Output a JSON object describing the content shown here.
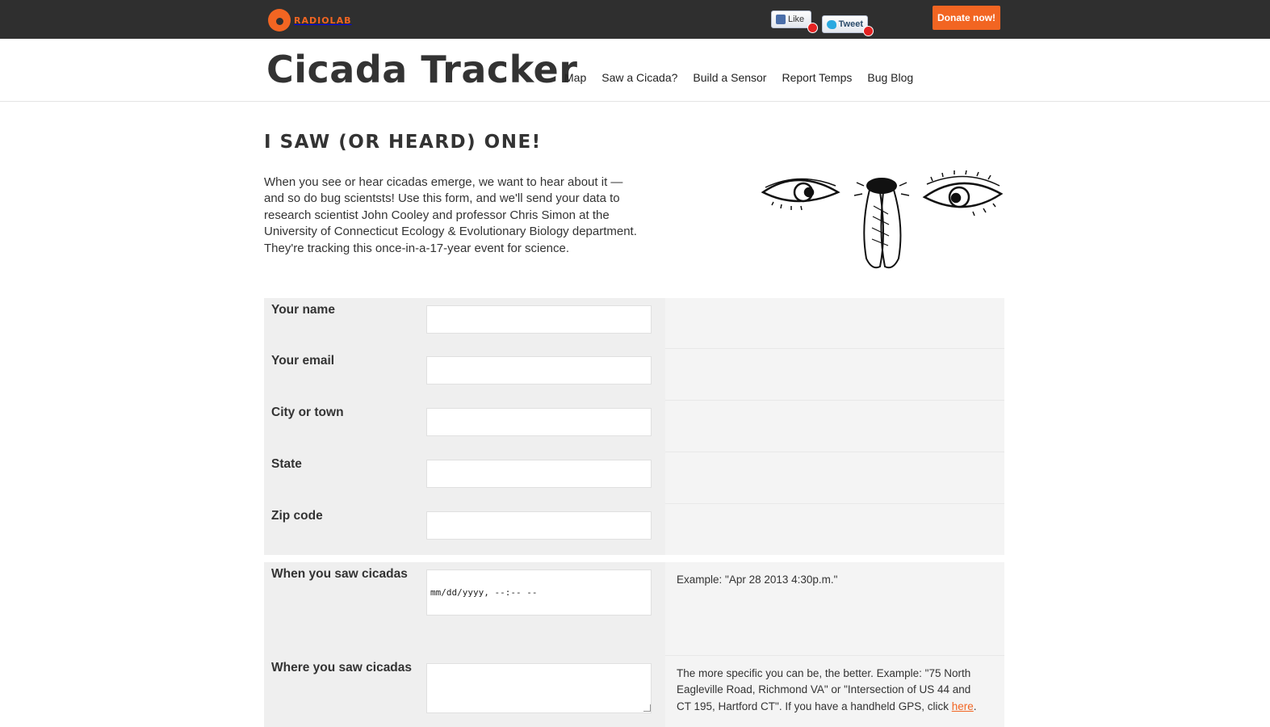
{
  "topbar": {
    "logo_text": "RADIOLAB",
    "fb_like_label": "Like",
    "tweet_label": "Tweet",
    "donate_label": "Donate now!",
    "accent_color": "#f26522"
  },
  "header": {
    "site_title": "Cicada Tracker",
    "nav": [
      {
        "label": "Map"
      },
      {
        "label": "Saw a Cicada?"
      },
      {
        "label": "Build a Sensor"
      },
      {
        "label": "Report Temps"
      },
      {
        "label": "Bug Blog"
      }
    ]
  },
  "main": {
    "title": "I SAW (OR HEARD) ONE!",
    "intro": "When you see or hear cicadas emerge, we want to hear about it — and so do bug scientsts! Use this form, and we'll send your data to research scientist John Cooley and professor Chris Simon at the University of Connecticut Ecology & Evolutionary Biology department. They're tracking this once-in-a-17-year event for science.",
    "illustration": "eyes-and-cicada-drawing"
  },
  "form": {
    "name_label": "Your name",
    "email_label": "Your email",
    "city_label": "City or town",
    "state_label": "State",
    "zip_label": "Zip code",
    "when_label": "When you saw cicadas",
    "when_value": "mm/dd/yyyy, --:-- --",
    "when_help": "Example: \"Apr 28 2013 4:30p.m.\"",
    "where_label": "Where you saw cicadas",
    "where_help": "The more specific you can be, the better. Example: \"75 North Eagleville Road, Richmond VA\" or \"Intersection of US 44 and CT 195, Hartford CT\". If you have a handheld GPS, click ",
    "where_help_link": "here",
    "where_help_end": "."
  }
}
